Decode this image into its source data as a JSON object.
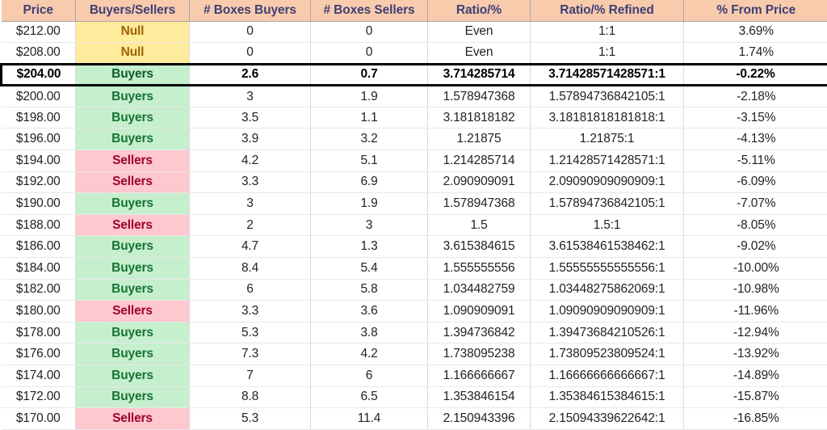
{
  "table": {
    "columns": [
      {
        "key": "price",
        "label": "Price"
      },
      {
        "key": "status",
        "label": "Buyers/Sellers"
      },
      {
        "key": "boxes_buyers",
        "label": "# Boxes Buyers"
      },
      {
        "key": "boxes_sellers",
        "label": "# Boxes Sellers"
      },
      {
        "key": "ratio",
        "label": "Ratio/%"
      },
      {
        "key": "refined",
        "label": "Ratio/% Refined"
      },
      {
        "key": "from_price",
        "label": "% From Price"
      }
    ],
    "header_bg": "#f8cbad",
    "header_text_color": "#3f3f76",
    "fill_colors": {
      "buyers": "#c6efce",
      "sellers": "#ffc7ce",
      "null": "#ffeb9c"
    },
    "text_colors": {
      "buyers": "#187334",
      "sellers": "#9c0032",
      "null": "#9c6500"
    },
    "highlight_border_color": "#000000",
    "rows": [
      {
        "price": "$212.00",
        "status": "Null",
        "status_kind": "null",
        "boxes_buyers": "0",
        "boxes_sellers": "0",
        "ratio": "Even",
        "refined": "1:1",
        "from_price": "3.69%",
        "highlighted": false
      },
      {
        "price": "$208.00",
        "status": "Null",
        "status_kind": "null",
        "boxes_buyers": "0",
        "boxes_sellers": "0",
        "ratio": "Even",
        "refined": "1:1",
        "from_price": "1.74%",
        "highlighted": false
      },
      {
        "price": "$204.00",
        "status": "Buyers",
        "status_kind": "buyers",
        "boxes_buyers": "2.6",
        "boxes_sellers": "0.7",
        "ratio": "3.714285714",
        "refined": "3.71428571428571:1",
        "from_price": "-0.22%",
        "highlighted": true
      },
      {
        "price": "$200.00",
        "status": "Buyers",
        "status_kind": "buyers",
        "boxes_buyers": "3",
        "boxes_sellers": "1.9",
        "ratio": "1.578947368",
        "refined": "1.57894736842105:1",
        "from_price": "-2.18%",
        "highlighted": false
      },
      {
        "price": "$198.00",
        "status": "Buyers",
        "status_kind": "buyers",
        "boxes_buyers": "3.5",
        "boxes_sellers": "1.1",
        "ratio": "3.181818182",
        "refined": "3.18181818181818:1",
        "from_price": "-3.15%",
        "highlighted": false
      },
      {
        "price": "$196.00",
        "status": "Buyers",
        "status_kind": "buyers",
        "boxes_buyers": "3.9",
        "boxes_sellers": "3.2",
        "ratio": "1.21875",
        "refined": "1.21875:1",
        "from_price": "-4.13%",
        "highlighted": false
      },
      {
        "price": "$194.00",
        "status": "Sellers",
        "status_kind": "sellers",
        "boxes_buyers": "4.2",
        "boxes_sellers": "5.1",
        "ratio": "1.214285714",
        "refined": "1.21428571428571:1",
        "from_price": "-5.11%",
        "highlighted": false
      },
      {
        "price": "$192.00",
        "status": "Sellers",
        "status_kind": "sellers",
        "boxes_buyers": "3.3",
        "boxes_sellers": "6.9",
        "ratio": "2.090909091",
        "refined": "2.09090909090909:1",
        "from_price": "-6.09%",
        "highlighted": false
      },
      {
        "price": "$190.00",
        "status": "Buyers",
        "status_kind": "buyers",
        "boxes_buyers": "3",
        "boxes_sellers": "1.9",
        "ratio": "1.578947368",
        "refined": "1.57894736842105:1",
        "from_price": "-7.07%",
        "highlighted": false
      },
      {
        "price": "$188.00",
        "status": "Sellers",
        "status_kind": "sellers",
        "boxes_buyers": "2",
        "boxes_sellers": "3",
        "ratio": "1.5",
        "refined": "1.5:1",
        "from_price": "-8.05%",
        "highlighted": false
      },
      {
        "price": "$186.00",
        "status": "Buyers",
        "status_kind": "buyers",
        "boxes_buyers": "4.7",
        "boxes_sellers": "1.3",
        "ratio": "3.615384615",
        "refined": "3.61538461538462:1",
        "from_price": "-9.02%",
        "highlighted": false
      },
      {
        "price": "$184.00",
        "status": "Buyers",
        "status_kind": "buyers",
        "boxes_buyers": "8.4",
        "boxes_sellers": "5.4",
        "ratio": "1.555555556",
        "refined": "1.55555555555556:1",
        "from_price": "-10.00%",
        "highlighted": false
      },
      {
        "price": "$182.00",
        "status": "Buyers",
        "status_kind": "buyers",
        "boxes_buyers": "6",
        "boxes_sellers": "5.8",
        "ratio": "1.034482759",
        "refined": "1.03448275862069:1",
        "from_price": "-10.98%",
        "highlighted": false
      },
      {
        "price": "$180.00",
        "status": "Sellers",
        "status_kind": "sellers",
        "boxes_buyers": "3.3",
        "boxes_sellers": "3.6",
        "ratio": "1.090909091",
        "refined": "1.09090909090909:1",
        "from_price": "-11.96%",
        "highlighted": false
      },
      {
        "price": "$178.00",
        "status": "Buyers",
        "status_kind": "buyers",
        "boxes_buyers": "5.3",
        "boxes_sellers": "3.8",
        "ratio": "1.394736842",
        "refined": "1.39473684210526:1",
        "from_price": "-12.94%",
        "highlighted": false
      },
      {
        "price": "$176.00",
        "status": "Buyers",
        "status_kind": "buyers",
        "boxes_buyers": "7.3",
        "boxes_sellers": "4.2",
        "ratio": "1.738095238",
        "refined": "1.73809523809524:1",
        "from_price": "-13.92%",
        "highlighted": false
      },
      {
        "price": "$174.00",
        "status": "Buyers",
        "status_kind": "buyers",
        "boxes_buyers": "7",
        "boxes_sellers": "6",
        "ratio": "1.166666667",
        "refined": "1.16666666666667:1",
        "from_price": "-14.89%",
        "highlighted": false
      },
      {
        "price": "$172.00",
        "status": "Buyers",
        "status_kind": "buyers",
        "boxes_buyers": "8.8",
        "boxes_sellers": "6.5",
        "ratio": "1.353846154",
        "refined": "1.35384615384615:1",
        "from_price": "-15.87%",
        "highlighted": false
      },
      {
        "price": "$170.00",
        "status": "Sellers",
        "status_kind": "sellers",
        "boxes_buyers": "5.3",
        "boxes_sellers": "11.4",
        "ratio": "2.150943396",
        "refined": "2.15094339622642:1",
        "from_price": "-16.85%",
        "highlighted": false
      }
    ]
  }
}
